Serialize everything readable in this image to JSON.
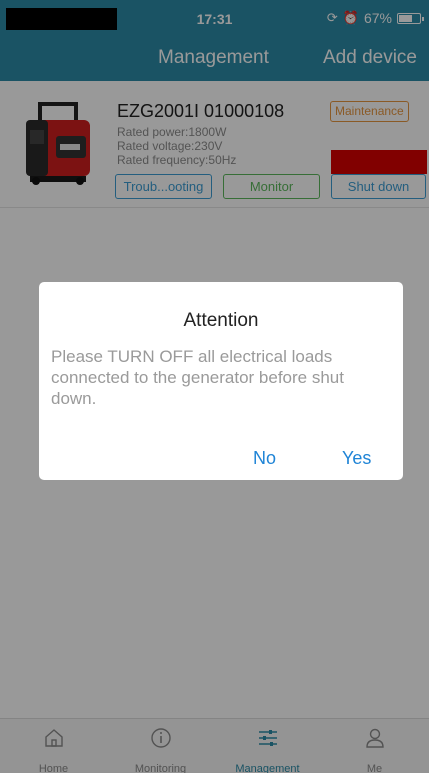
{
  "status_bar": {
    "time": "17:31",
    "battery_percent": "67%",
    "battery_level": 0.67,
    "icons": [
      "orientation-lock-icon",
      "alarm-icon",
      "battery-icon"
    ]
  },
  "nav": {
    "title": "Management",
    "action": "Add device"
  },
  "device": {
    "name": "EZG2001I 01000108",
    "rated_power": "Rated power:1800W",
    "rated_voltage": "Rated voltage:230V",
    "rated_frequency": "Rated frequency:50Hz",
    "maintenance_label": "Maintenance",
    "troubleshooting_label": "Troub...ooting",
    "monitor_label": "Monitor",
    "shutdown_label": "Shut down",
    "image_icon": "generator-image"
  },
  "dialog": {
    "title": "Attention",
    "message": "Please TURN OFF all electrical loads connected to the generator before shut down.",
    "no_label": "No",
    "yes_label": "Yes"
  },
  "tabs": [
    {
      "label": "Home",
      "icon": "home-icon"
    },
    {
      "label": "Monitoring",
      "icon": "info-icon"
    },
    {
      "label": "Management",
      "icon": "sliders-icon"
    },
    {
      "label": "Me",
      "icon": "user-icon"
    }
  ],
  "active_tab": "Management",
  "colors": {
    "header": "#2c8ba7",
    "maintenance": "#e79640",
    "link_blue": "#3c9dd4",
    "monitor_green": "#5cb85c",
    "alert_red": "#d80000",
    "dialog_button": "#1f84d6"
  }
}
